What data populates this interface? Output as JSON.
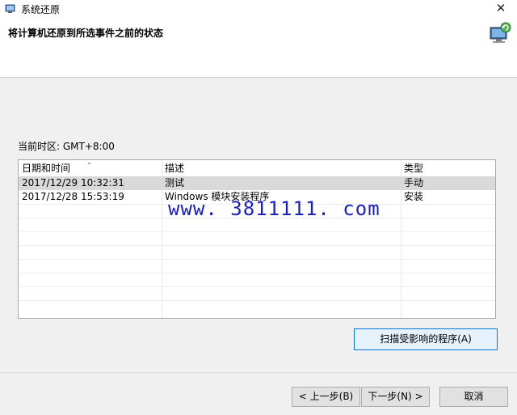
{
  "window": {
    "title": "系统还原",
    "close_glyph": "✕"
  },
  "header": {
    "title": "将计算机还原到所选事件之前的状态",
    "icon": "system-restore-icon"
  },
  "timezone_label": "当前时区: GMT+8:00",
  "table": {
    "columns": [
      "日期和时间",
      "描述",
      "类型"
    ],
    "rows": [
      {
        "date": "2017/12/29 10:32:31",
        "description": "测试",
        "type": "手动",
        "selected": true
      },
      {
        "date": "2017/12/28 15:53:19",
        "description": "Windows 模块安装程序",
        "type": "安装",
        "selected": false
      }
    ]
  },
  "watermark": "www. 3811111. com",
  "buttons": {
    "scan": "扫描受影响的程序(A)",
    "back": "< 上一步(B)",
    "next": "下一步(N) >",
    "cancel": "取消"
  },
  "colors": {
    "accent_border": "#0078d7",
    "selection": "#d9d9d9",
    "watermark": "#1a21c4"
  }
}
